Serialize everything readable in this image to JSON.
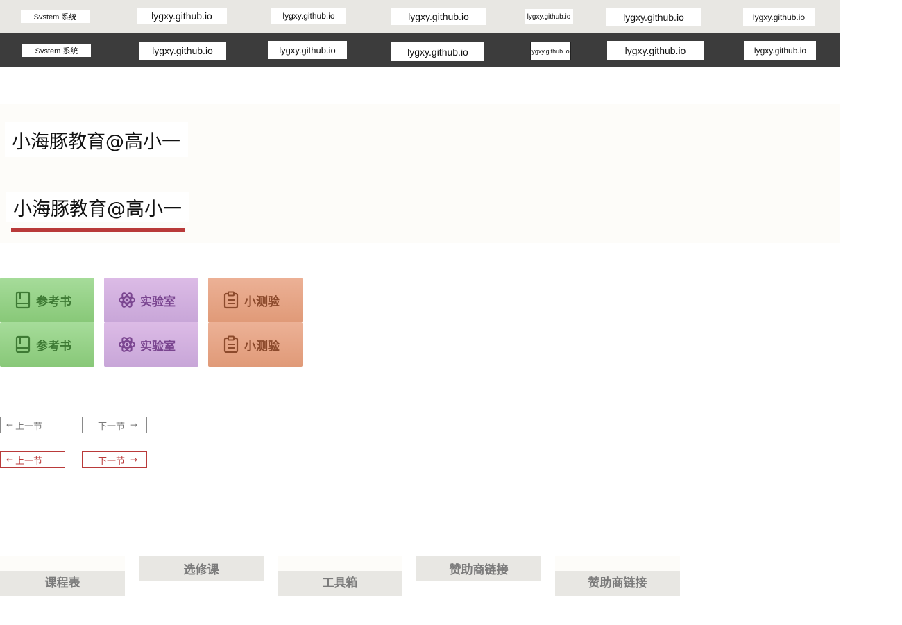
{
  "top_bar": {
    "items": [
      "Svstem  系统",
      "lygxy.github.io",
      "lygxy.github.io",
      "lygxy.github.io",
      "lygxy.github.io",
      "lygxy.github.io",
      "lygxy.github.io"
    ]
  },
  "dark_bar": {
    "items": [
      "Svstem  系统",
      "lygxy.github.io",
      "lygxy.github.io",
      "lygxy.github.io",
      "ygxy.github.io",
      "lygxy.github.io",
      "lygxy.github.io"
    ]
  },
  "brand": {
    "title_plain": "小海豚教育@高小一",
    "title_underlined": "小海豚教育@高小一",
    "accent_color": "#b93a3a"
  },
  "tiles": {
    "row1": [
      {
        "label": "参考书",
        "icon": "book-icon"
      },
      {
        "label": "实验室",
        "icon": "atom-icon"
      },
      {
        "label": "小测验",
        "icon": "clipboard-icon"
      }
    ],
    "row2": [
      {
        "label": "参考书",
        "icon": "book-icon"
      },
      {
        "label": "实验室",
        "icon": "atom-icon"
      },
      {
        "label": "小测验",
        "icon": "clipboard-icon"
      }
    ]
  },
  "pager": {
    "grey": {
      "prev": "上一节",
      "next": "下一节"
    },
    "red": {
      "prev": "上一节",
      "next": "下一节"
    }
  },
  "footer_tabs": [
    "课程表",
    "选修课",
    "工具箱",
    "赞助商链接",
    "赞助商链接"
  ]
}
